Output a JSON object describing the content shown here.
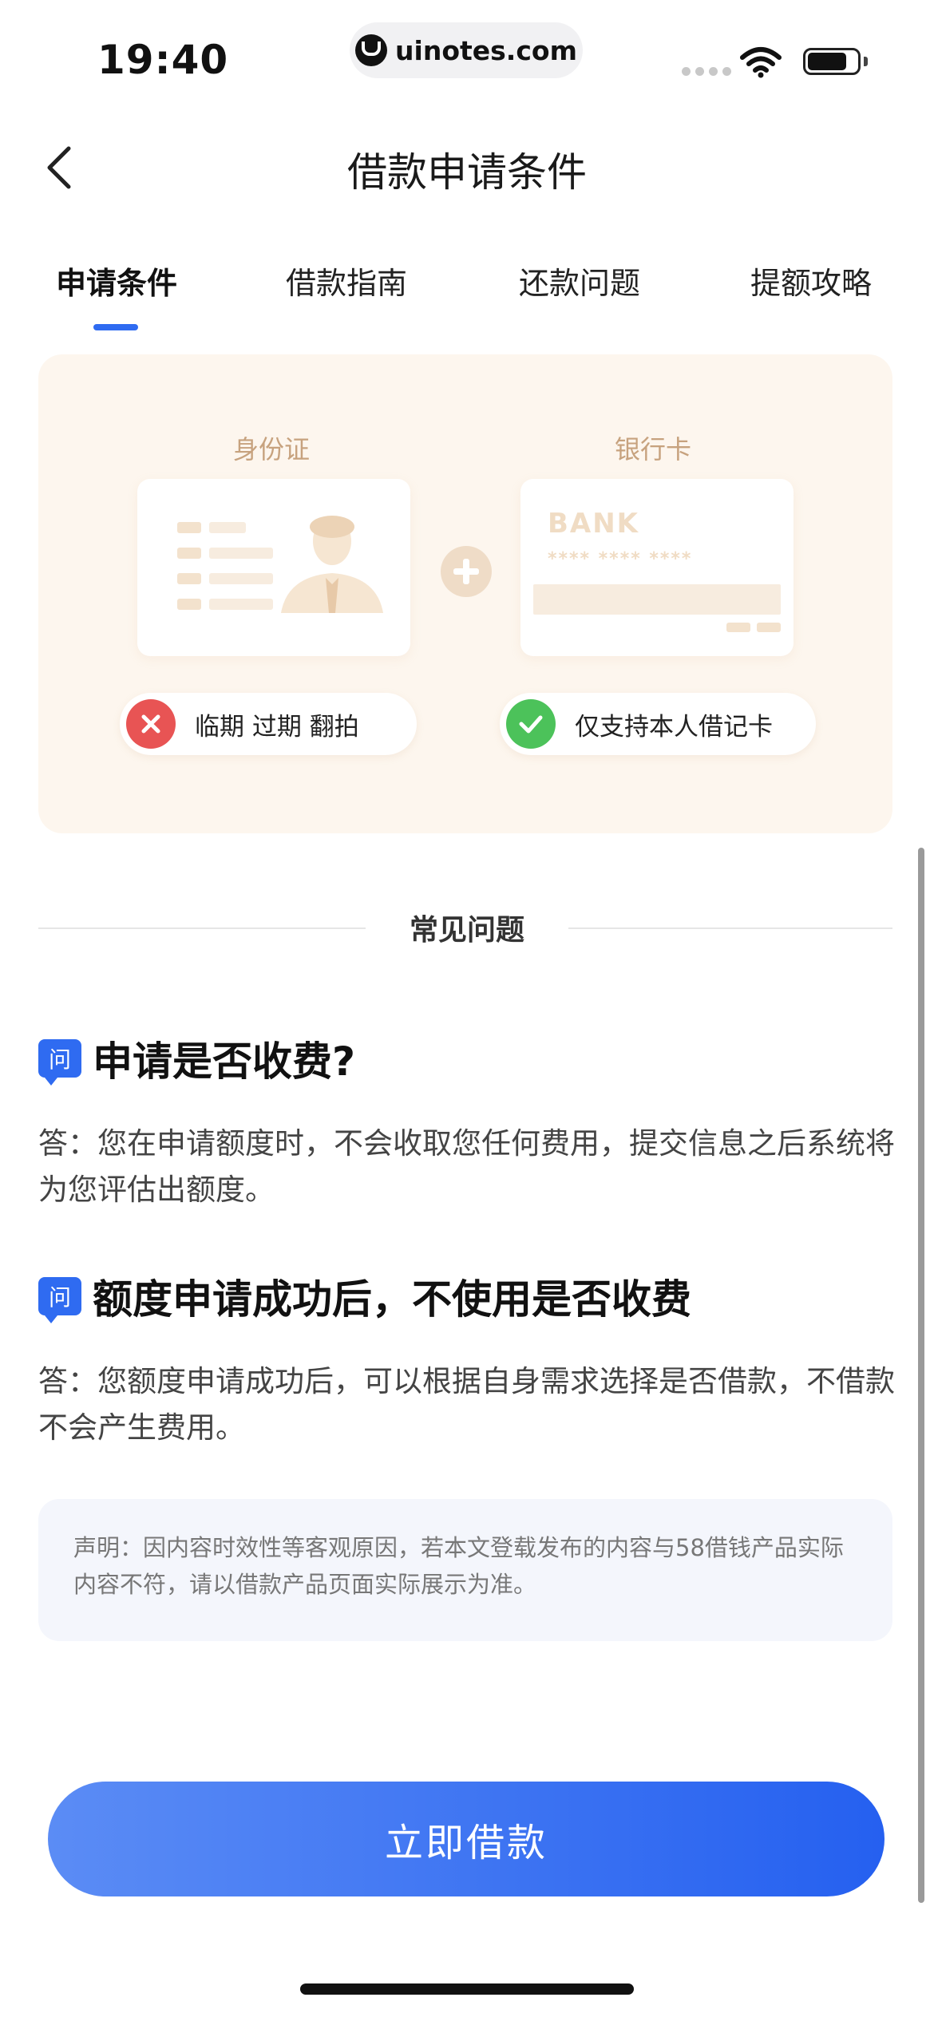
{
  "status_bar": {
    "time": "19:40",
    "url": "uinotes.com",
    "logo_icon": "uinotes-logo-icon",
    "signal_icon": "signal-dots-icon",
    "wifi_icon": "wifi-icon",
    "battery_icon": "battery-icon",
    "battery_level": 0.8
  },
  "nav": {
    "title": "借款申请条件",
    "back_icon": "chevron-left-icon"
  },
  "tabs": {
    "items": [
      {
        "label": "申请条件",
        "active": true
      },
      {
        "label": "借款指南",
        "active": false
      },
      {
        "label": "还款问题",
        "active": false
      },
      {
        "label": "提额攻略",
        "active": false
      }
    ],
    "accent": "#2f6bf1"
  },
  "requirements": {
    "id_card": {
      "title": "身份证",
      "note": "临期 过期 翻拍",
      "status_icon": "x-circle-icon",
      "status_color": "#e85454"
    },
    "bank_card": {
      "title": "银行卡",
      "card_brand": "BANK",
      "card_number": "**** **** ****",
      "note": "仅支持本人借记卡",
      "status_icon": "check-circle-icon",
      "status_color": "#4cc25a"
    },
    "plus_icon": "plus-circle-icon",
    "background": "#fdf6ee"
  },
  "faq": {
    "title": "常见问题",
    "question_badge": "问",
    "items": [
      {
        "question": "申请是否收费?",
        "answer": "答：您在申请额度时，不会收取您任何费用，提交信息之后系统将为您评估出额度。"
      },
      {
        "question": "额度申请成功后，不使用是否收费",
        "answer": "答：您额度申请成功后，可以根据自身需求选择是否借款，不借款不会产生费用。"
      }
    ]
  },
  "disclaimer": "声明：因内容时效性等客观原因，若本文登载发布的内容与58借钱产品实际内容不符，请以借款产品页面实际展示为准。",
  "cta": {
    "label": "立即借款",
    "color": "#2f6bf1"
  }
}
